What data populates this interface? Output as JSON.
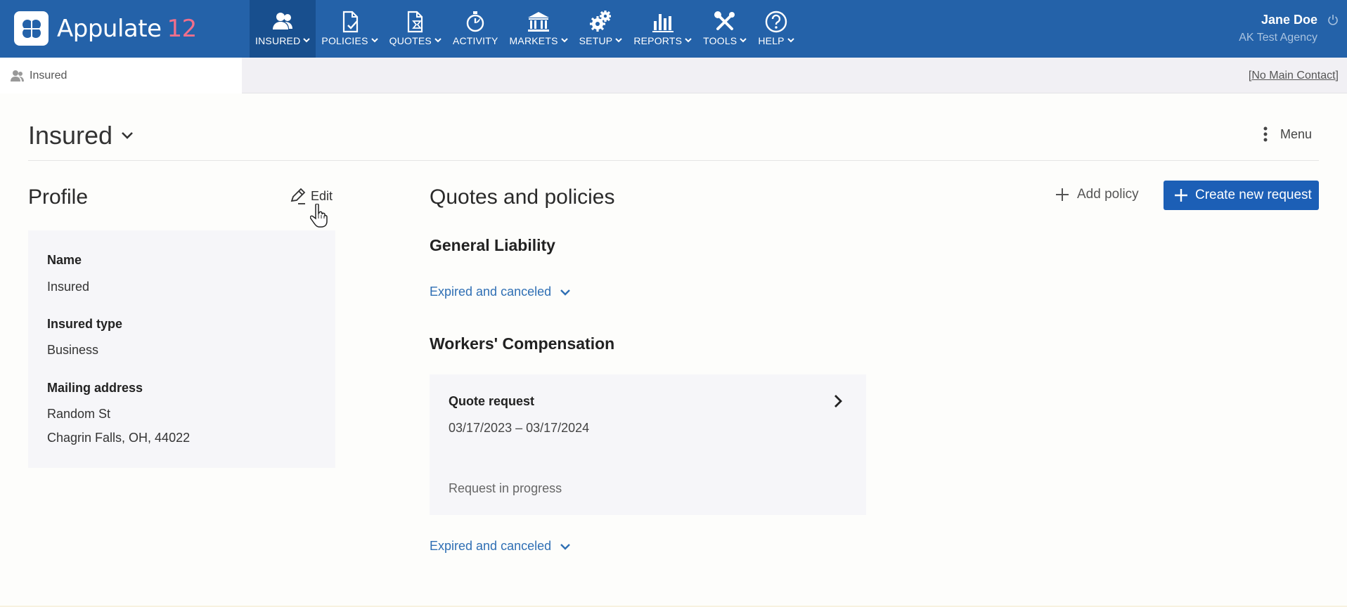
{
  "app": {
    "name": "Appulate",
    "version": "12"
  },
  "nav": [
    {
      "key": "insured",
      "label": "INSURED",
      "icon": "users-icon",
      "dropdown": true,
      "active": true
    },
    {
      "key": "policies",
      "label": "POLICIES",
      "icon": "policy-icon",
      "dropdown": true
    },
    {
      "key": "quotes",
      "label": "QUOTES",
      "icon": "quote-icon",
      "dropdown": true
    },
    {
      "key": "activity",
      "label": "ACTIVITY",
      "icon": "stopwatch-icon",
      "dropdown": false
    },
    {
      "key": "markets",
      "label": "MARKETS",
      "icon": "bank-icon",
      "dropdown": true
    },
    {
      "key": "setup",
      "label": "SETUP",
      "icon": "gears-icon",
      "dropdown": true
    },
    {
      "key": "reports",
      "label": "REPORTS",
      "icon": "bar-chart-icon",
      "dropdown": true
    },
    {
      "key": "tools",
      "label": "TOOLS",
      "icon": "tools-icon",
      "dropdown": true
    },
    {
      "key": "help",
      "label": "HELP",
      "icon": "help-icon",
      "dropdown": true
    }
  ],
  "user": {
    "name": "Jane Doe",
    "agency": "AK Test Agency"
  },
  "subbar": {
    "tab_label": "Insured",
    "contact_open": "[",
    "contact": "No Main Contact",
    "contact_close": "]"
  },
  "page": {
    "title": "Insured",
    "menu_label": "Menu"
  },
  "profile": {
    "title": "Profile",
    "edit_label": "Edit",
    "name_label": "Name",
    "name_value": "Insured",
    "type_label": "Insured type",
    "type_value": "Business",
    "address_label": "Mailing address",
    "address_line1": "Random St",
    "address_line2": "Chagrin Falls, OH, 44022"
  },
  "quotes_policies": {
    "title": "Quotes and policies",
    "add_policy_label": "Add policy",
    "create_request_label": "Create new request",
    "sections": [
      {
        "title": "General Liability",
        "expired_label": "Expired and canceled"
      },
      {
        "title": "Workers' Compensation",
        "expired_label": "Expired and canceled"
      }
    ],
    "quote_card": {
      "title": "Quote request",
      "dates": "03/17/2023 – 03/17/2024",
      "status": "Request in progress"
    }
  },
  "colors": {
    "header": "#2462a9",
    "header_active": "#184f8e",
    "primary_button": "#1c5fb6",
    "link": "#2f6fb4",
    "logo_version": "#f06f8b"
  }
}
